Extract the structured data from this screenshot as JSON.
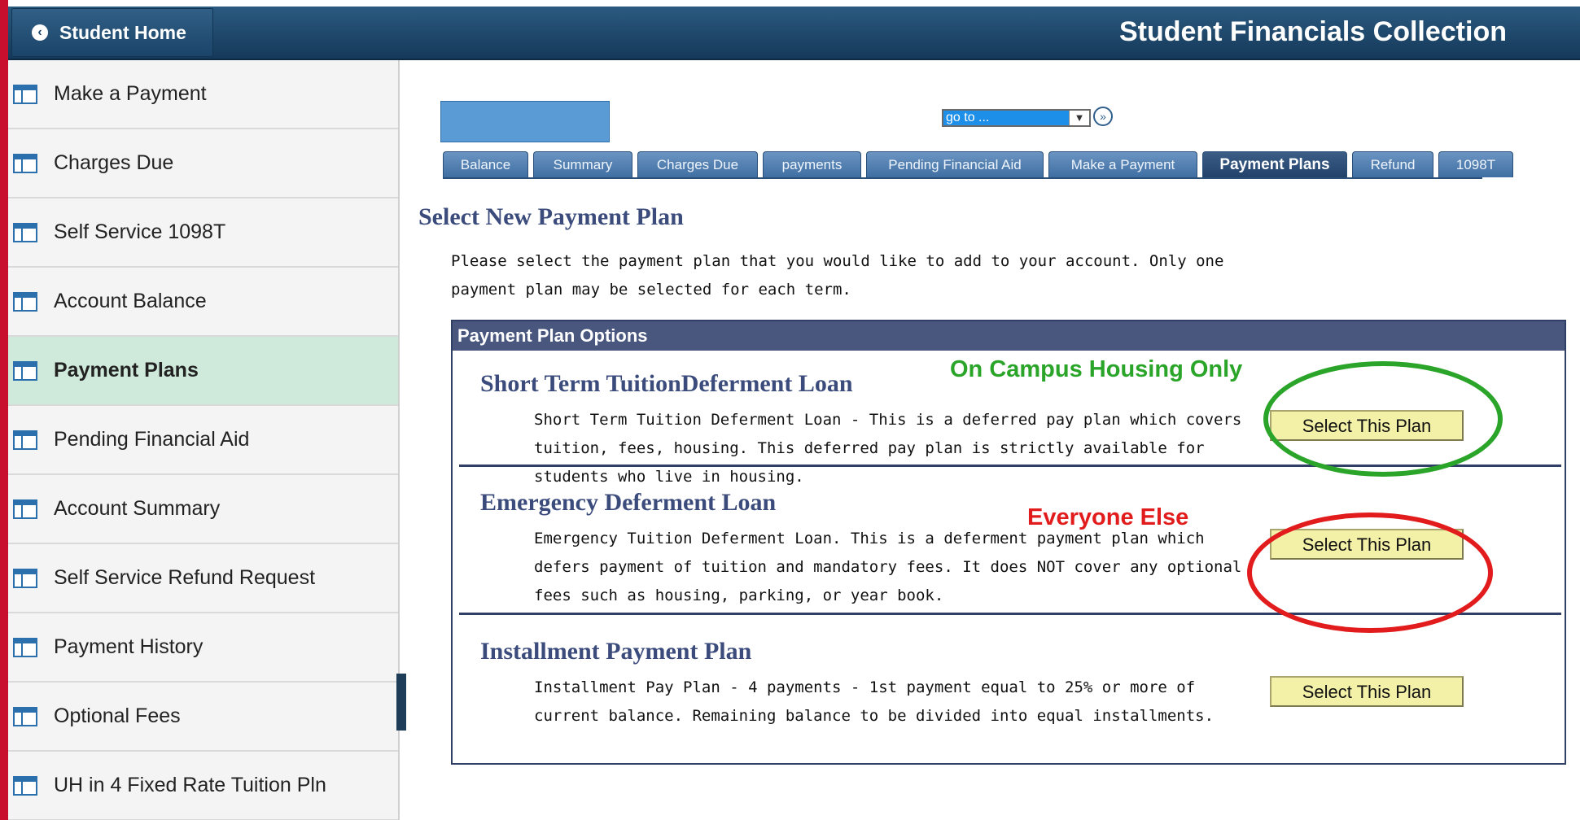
{
  "header": {
    "home_label": "Student Home",
    "title": "Student Financials Collection"
  },
  "sidebar": {
    "items": [
      {
        "label": "Make a Payment",
        "active": false
      },
      {
        "label": "Charges Due",
        "active": false
      },
      {
        "label": "Self Service 1098T",
        "active": false
      },
      {
        "label": "Account Balance",
        "active": false
      },
      {
        "label": "Payment Plans",
        "active": true
      },
      {
        "label": "Pending Financial Aid",
        "active": false
      },
      {
        "label": "Account Summary",
        "active": false
      },
      {
        "label": "Self Service Refund Request",
        "active": false
      },
      {
        "label": "Payment History",
        "active": false
      },
      {
        "label": "Optional Fees",
        "active": false
      },
      {
        "label": "UH in 4 Fixed Rate Tuition Pln",
        "active": false
      }
    ]
  },
  "goto": {
    "selected": "go to ..."
  },
  "tabs": [
    "Balance",
    "Summary",
    "Charges Due",
    "payments",
    "Pending Financial Aid",
    "Make a Payment",
    "Payment Plans",
    "Refund",
    "1098T"
  ],
  "active_tab": "Payment Plans",
  "main": {
    "title": "Select New Payment Plan",
    "intro": "Please select the payment plan that you would like to add to your account. Only one payment plan may be selected for each term."
  },
  "options": {
    "header": "Payment Plan Options",
    "plans": [
      {
        "title": "Short Term TuitionDeferment Loan",
        "desc": "Short Term Tuition Deferment Loan - This is a deferred pay plan which covers tuition, fees, housing. This deferred pay plan is strictly available for students who live in housing.",
        "button": "Select This Plan"
      },
      {
        "title": "Emergency Deferment Loan",
        "desc": "Emergency Tuition Deferment Loan. This is a deferment payment plan which defers payment of tuition and mandatory fees. It does NOT cover any optional fees such as housing, parking, or year book.",
        "button": "Select This Plan"
      },
      {
        "title": "Installment Payment Plan",
        "desc": "Installment Pay Plan - 4 payments - 1st payment equal to 25% or more of current balance. Remaining balance to be divided into equal  installments.",
        "button": "Select This Plan"
      }
    ]
  },
  "annotations": {
    "note1": "On Campus Housing Only",
    "note1_color": "#2aa52a",
    "note2": "Everyone Else",
    "note2_color": "#e21c1c"
  }
}
